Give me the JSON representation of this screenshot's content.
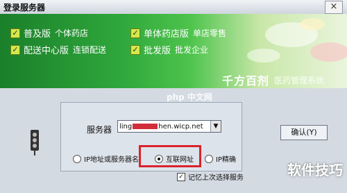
{
  "window": {
    "title": "登录服务器",
    "close_glyph": "×"
  },
  "banner": {
    "items": [
      {
        "label": "普及版",
        "sub": "个体药店"
      },
      {
        "label": "单体药店版",
        "sub": "单店零售"
      },
      {
        "label": "配送中心版",
        "sub": "连锁配送"
      },
      {
        "label": "批发版",
        "sub": "批发企业"
      }
    ],
    "logo": "千方百剂",
    "logo_sub": "医药管理系统"
  },
  "form": {
    "server_label": "服务器",
    "server_value_start": "ling",
    "server_value_end": "hen.wicp.net",
    "confirm_button": "确认(Y)",
    "radio_options": [
      {
        "label": "IP地址或服务器名",
        "selected": false
      },
      {
        "label": "互联网址",
        "selected": true
      },
      {
        "label": "IP精确",
        "selected": false
      }
    ],
    "remember_label": "记忆上次选择服务",
    "remember_checked": true
  },
  "watermarks": {
    "top": "php 中文网",
    "bottom": "软件技巧"
  },
  "colors": {
    "highlight": "#d9232d",
    "banner_green": "#2fa73b"
  }
}
